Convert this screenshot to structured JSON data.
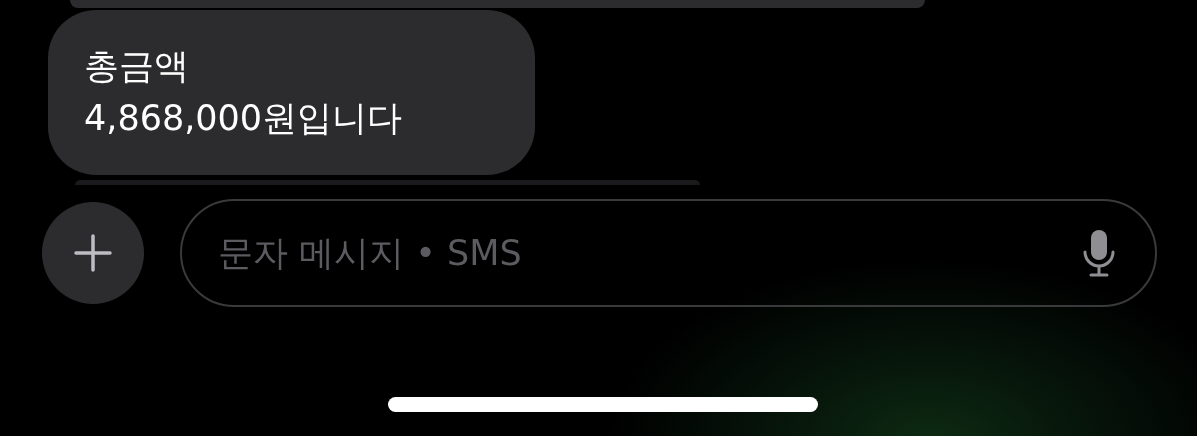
{
  "messages": [
    {
      "text": "총금액\n4,868,000원입니다"
    }
  ],
  "composer": {
    "placeholder": "문자 메시지 • SMS"
  }
}
